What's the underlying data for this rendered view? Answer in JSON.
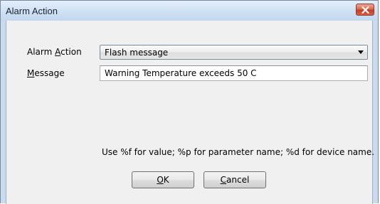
{
  "window": {
    "title": "Alarm Action"
  },
  "form": {
    "alarm_action_label_prefix": "Alarm ",
    "alarm_action_label_accel": "A",
    "alarm_action_label_rest": "ction",
    "alarm_action_value": "Flash message",
    "message_label_accel": "M",
    "message_label_rest": "essage",
    "message_value": "Warning Temperature exceeds 50 C",
    "hint": "Use %f for value; %p for parameter name; %d for device name."
  },
  "buttons": {
    "ok_accel": "O",
    "ok_rest": "K",
    "cancel_accel": "C",
    "cancel_rest": "ancel"
  },
  "icons": {
    "close": "close-icon",
    "dropdown": "chevron-down-icon"
  },
  "colors": {
    "titlebar": "#d2e3f5",
    "client": "#f0f0f0",
    "close_button": "#c33d22"
  }
}
